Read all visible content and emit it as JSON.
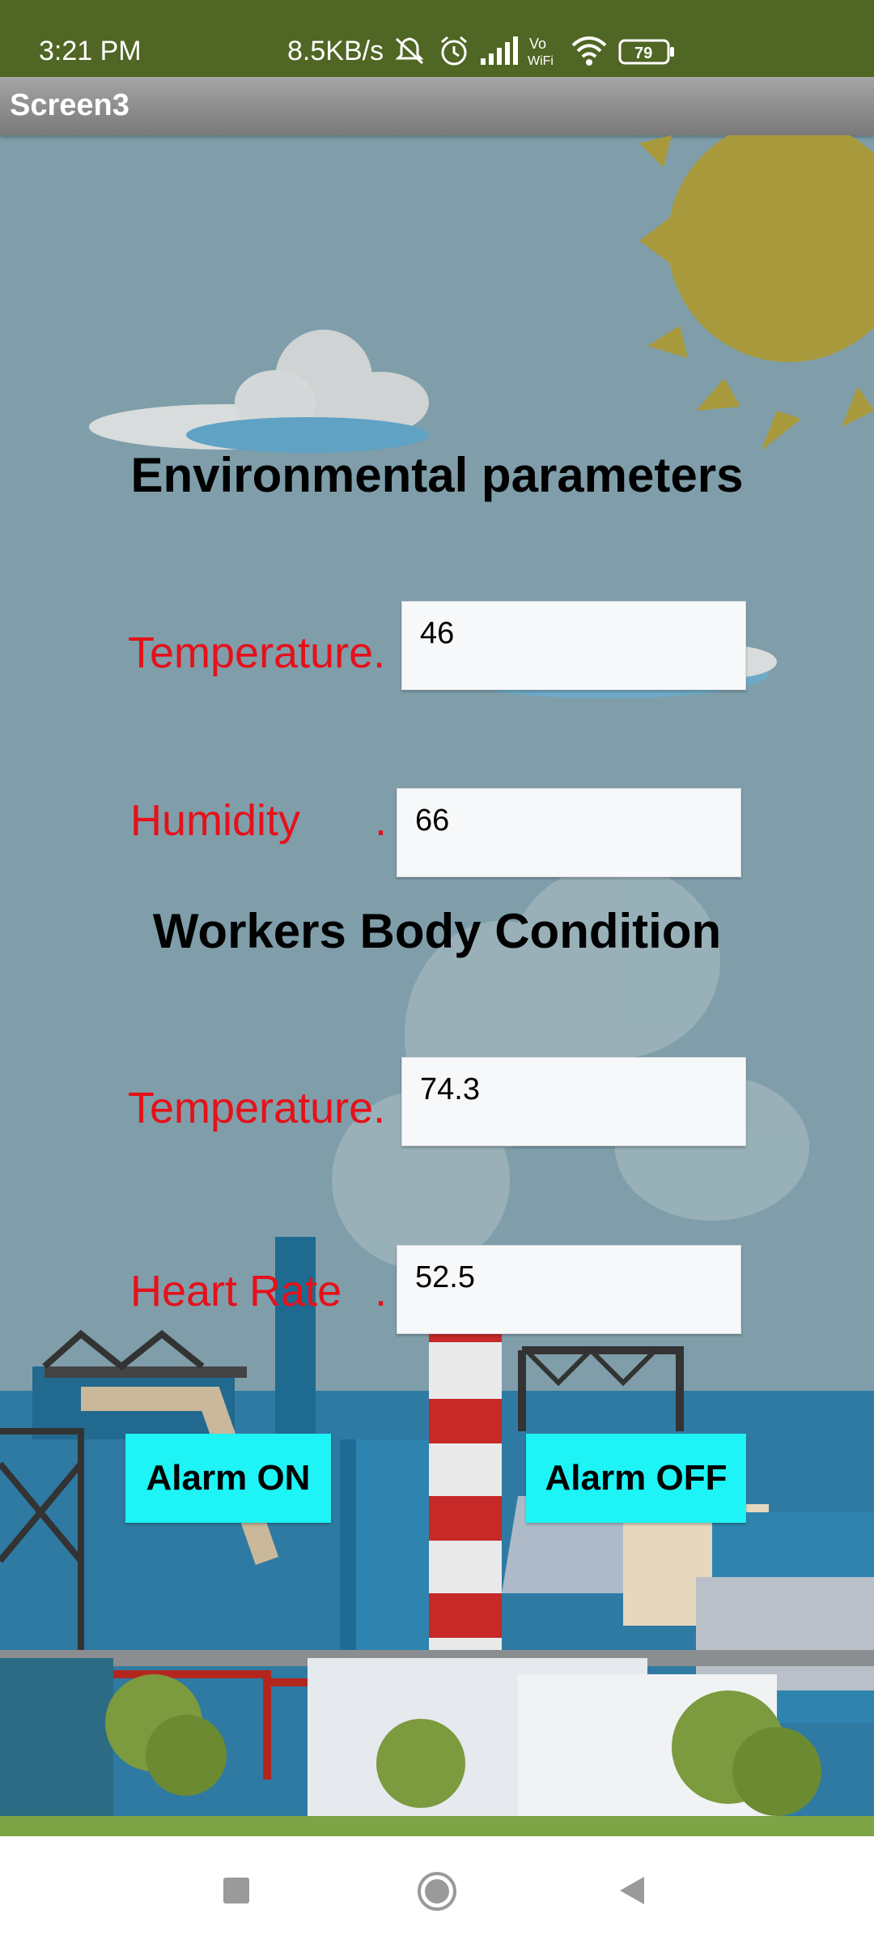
{
  "status_bar": {
    "time": "3:21 PM",
    "network_speed": "8.5KB/s",
    "battery_level": "79",
    "icons": [
      "mute-icon",
      "alarm-icon",
      "signal-icon",
      "vowifi-icon",
      "wifi-icon",
      "battery-icon"
    ],
    "vowifi_top": "Vo",
    "vowifi_bottom": "WiFi"
  },
  "app_bar": {
    "title": "Screen3"
  },
  "environment": {
    "heading": "Environmental parameters",
    "temperature_label": "Temperature.",
    "temperature_value": "46",
    "humidity_label": "Humidity",
    "humidity_dot": ".",
    "humidity_value": "66"
  },
  "workers": {
    "heading": "Workers Body Condition",
    "temperature_label": "Temperature.",
    "temperature_value": "74.3",
    "heart_rate_label": "Heart Rate",
    "heart_rate_dot": ".",
    "heart_rate_value": "52.5"
  },
  "buttons": {
    "alarm_on": "Alarm ON",
    "alarm_off": "Alarm OFF"
  },
  "colors": {
    "status_bar": "#506624",
    "background": "#7f9eaa",
    "label_red": "#e5111a",
    "button_cyan": "#1ef3f5",
    "sun": "#a89a3c"
  },
  "nav_bar": {
    "icons": [
      "recents-square-icon",
      "home-circle-icon",
      "back-triangle-icon"
    ]
  }
}
